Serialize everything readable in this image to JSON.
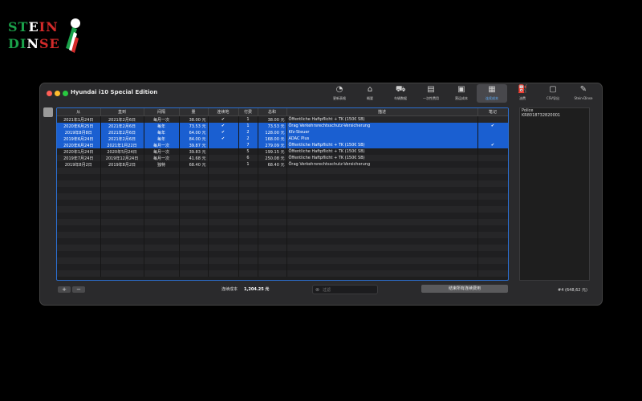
{
  "logo": {
    "line1": "STEIN",
    "line2": "DINSE"
  },
  "window": {
    "title": "Hyundai i10 Special Edition"
  },
  "toolbar": [
    {
      "label": "更新表格",
      "icon": "gauge-icon"
    },
    {
      "label": "概要",
      "icon": "home-icon"
    },
    {
      "label": "车辆数据",
      "icon": "car-icon"
    },
    {
      "label": "一次性费用",
      "icon": "receipt-icon"
    },
    {
      "label": "营运成本",
      "icon": "coins-icon"
    },
    {
      "label": "连续成本",
      "icon": "car-cost-icon",
      "active": true
    },
    {
      "label": "油费",
      "icon": "fuel-pump-icon"
    },
    {
      "label": "CSV导出",
      "icon": "csv-export-icon"
    },
    {
      "label": "Stein-Dinse",
      "icon": "pen-icon"
    }
  ],
  "table": {
    "headers": [
      "从",
      "直到",
      "间隔",
      "量",
      "连续地",
      "付费",
      "总和",
      "描述",
      "笔记"
    ],
    "rows": [
      {
        "from": "2021年1月24日",
        "to": "2021年2月6日",
        "interval": "每月一次",
        "amount": "38.00 元",
        "cont": "✔",
        "paid": "1",
        "sum": "38.00 元",
        "desc": "Öffentliche Haftpflicht + TK (150€ SB)",
        "note": "",
        "selected": false
      },
      {
        "from": "2020年6月25日",
        "to": "2021年2月6日",
        "interval": "每年",
        "amount": "73.53 元",
        "cont": "✔",
        "paid": "1",
        "sum": "73.53 元",
        "desc": "Örag Verkehrsrechtsschutz-Versicherung",
        "note": "✔",
        "selected": true
      },
      {
        "from": "2019年8月8日",
        "to": "2021年2月6日",
        "interval": "每年",
        "amount": "64.00 元",
        "cont": "✔",
        "paid": "2",
        "sum": "128.00 元",
        "desc": "Kfz-Steuer",
        "note": "",
        "selected": true
      },
      {
        "from": "2019年6月24日",
        "to": "2021年2月6日",
        "interval": "每年",
        "amount": "84.00 元",
        "cont": "✔",
        "paid": "2",
        "sum": "168.00 元",
        "desc": "ADAC Plus",
        "note": "",
        "selected": true
      },
      {
        "from": "2020年6月24日",
        "to": "2021年1月22日",
        "interval": "每月一次",
        "amount": "39.87 元",
        "cont": "",
        "paid": "7",
        "sum": "279.09 元",
        "desc": "Öffentliche Haftpflicht + TK (150€ SB)",
        "note": "✔",
        "selected": true
      },
      {
        "from": "2020年1月24日",
        "to": "2020年5月24日",
        "interval": "每月一次",
        "amount": "39.83 元",
        "cont": "",
        "paid": "5",
        "sum": "199.15 元",
        "desc": "Öffentliche Haftpflicht + TK (150€ SB)",
        "note": "",
        "selected": false
      },
      {
        "from": "2019年7月24日",
        "to": "2019年12月24日",
        "interval": "每月一次",
        "amount": "41.68 元",
        "cont": "",
        "paid": "6",
        "sum": "250.08 元",
        "desc": "Öffentliche Haftpflicht + TK (150€ SB)",
        "note": "",
        "selected": false
      },
      {
        "from": "2019年8月2日",
        "to": "2019年8月2日",
        "interval": "独特",
        "amount": "68.40 元",
        "cont": "",
        "paid": "1",
        "sum": "68.40 元",
        "desc": "Örag Verkehrsrechtsschutz-Versicherung",
        "note": "",
        "selected": false
      }
    ]
  },
  "footer": {
    "add": "+",
    "remove": "−",
    "cost_label": "连续成本",
    "cost_value": "1,204.25 元",
    "filter_placeholder": "过滤",
    "end_button": "结束所有连续费用",
    "count": "#4 (648,62 元)"
  },
  "notes": {
    "line1": "Police",
    "line2": "KR8018732820001"
  },
  "colors": {
    "accent": "#1a5fd1",
    "window_bg": "#2a2a2c"
  }
}
